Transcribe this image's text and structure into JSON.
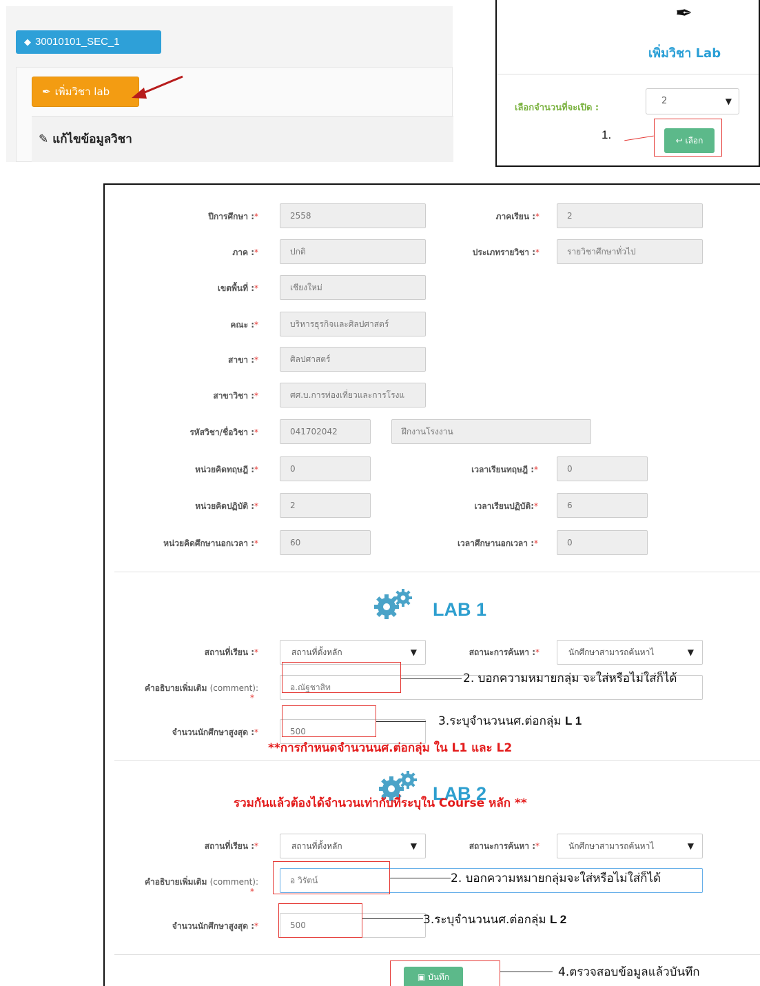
{
  "top_left": {
    "section_tag": "30010101_SEC_1",
    "add_lab_button": "เพิ่มวิชา lab",
    "edit_header": "แก้ไขข้อมูลวิชา"
  },
  "top_right": {
    "title": "เพิ่มวิชา Lab",
    "select_label": "เลือกจำนวนที่จะเปิด :",
    "select_value": "2",
    "step_number": "1.",
    "choose_button": "เลือก"
  },
  "form": {
    "academic_year": {
      "label": "ปีการศึกษา :",
      "value": "2558"
    },
    "semester": {
      "label": "ภาคเรียน :",
      "value": "2"
    },
    "term": {
      "label": "ภาค :",
      "value": "ปกติ"
    },
    "course_type": {
      "label": "ประเภทรายวิชา :",
      "value": "รายวิชาศึกษาทั่วไป"
    },
    "campus": {
      "label": "เขตพื้นที่ :",
      "value": "เชียงใหม่"
    },
    "faculty": {
      "label": "คณะ :",
      "value": "บริหารธุรกิจและศิลปศาสตร์"
    },
    "department": {
      "label": "สาขา :",
      "value": "ศิลปศาสตร์"
    },
    "program": {
      "label": "สาขาวิชา :",
      "value": "ศศ.บ.การท่องเที่ยวและการโรงแ"
    },
    "course": {
      "label": "รหัสวิชา/ชื่อวิชา :",
      "code": "041702042",
      "name": "ฝึกงานโรงงาน"
    },
    "theory_credits": {
      "label": "หน่วยคิดทฤษฎี :",
      "value": "0"
    },
    "theory_hours": {
      "label": "เวลาเรียนทฤษฎี :",
      "value": "0"
    },
    "practice_credits": {
      "label": "หน่วยคิดปฏิบัติ :",
      "value": "2"
    },
    "practice_hours": {
      "label": "เวลาเรียนปฏิบัติ:",
      "value": "6"
    },
    "self_study_credits": {
      "label": "หน่วยคิดศึกษานอกเวลา :",
      "value": "60"
    },
    "self_study_hours": {
      "label": "เวลาศึกษานอกเวลา :",
      "value": "0"
    },
    "required_mark": "*"
  },
  "labs": [
    {
      "heading": "LAB 1",
      "location_label": "สถานที่เรียน :",
      "location_value": "สถานที่ตั้งหลัก",
      "search_label": "สถานะการค้นหา :",
      "search_value": "นักศึกษาสามารถค้นหาไ",
      "comment_label": "คำอธิบายเพิ่มเติม",
      "comment_suffix": "(comment):",
      "comment_value": "อ.ณัฐชาสิท",
      "max_label": "จำนวนนักศึกษาสูงสุด :",
      "max_value": "500"
    },
    {
      "heading": "LAB 2",
      "location_label": "สถานที่เรียน :",
      "location_value": "สถานที่ตั้งหลัก",
      "search_label": "สถานะการค้นหา :",
      "search_value": "นักศึกษาสามารถค้นหาไ",
      "comment_label": "คำอธิบายเพิ่มเติม",
      "comment_suffix": "(comment):",
      "comment_value": "อ วิรัตน์",
      "max_label": "จำนวนนักศึกษาสูงสุด :",
      "max_value": "500"
    }
  ],
  "annotations": {
    "note_comment_1": "2. บอกความหมายกลุ่ม จะใส่หรือไม่ใส่ก็ได้",
    "note_max_1_prefix": "3.ระบุจำนวนนศ.ต่อกลุ่ม",
    "note_max_1_bold": "L 1",
    "warning_line_1": "**การกำหนดจำนวนนศ.ต่อกลุ่ม ใน L1 และ L2",
    "warning_line_2": "รวมกันแล้วต้องได้จำนวนเท่ากับที่ระบุใน Course หลัก **",
    "note_comment_2": "2. บอกความหมายกลุ่มจะใส่หรือไม่ใส่ก็ได้",
    "note_max_2_prefix": "3.ระบุจำนวนนศ.ต่อกลุ่ม",
    "note_max_2_bold": "L 2",
    "note_save": "4.ตรวจสอบข้อมูลแล้วบันทึก"
  },
  "save_button": "บันทึก",
  "colors": {
    "tag_blue": "#2ea0d8",
    "add_orange": "#f39c12",
    "green_button": "#5cb98a",
    "lab_heading": "#2e9fcf",
    "annotation_red": "#e53935",
    "warning_red": "#e31b1b"
  },
  "icons": [
    "tag-icon",
    "feather-icon",
    "pencil-icon",
    "gears-icon",
    "reply-icon",
    "floppy-icon",
    "red-arrow"
  ]
}
